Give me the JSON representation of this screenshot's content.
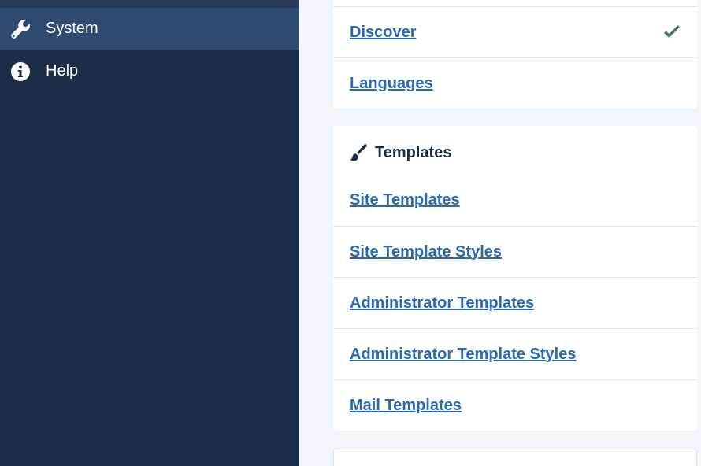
{
  "sidebar": {
    "items": [
      {
        "label": "System",
        "icon": "wrench-icon",
        "active": true
      },
      {
        "label": "Help",
        "icon": "info-icon",
        "active": false
      }
    ]
  },
  "install_card": {
    "links": [
      {
        "label": "Discover",
        "status_icon": "check-icon"
      },
      {
        "label": "Languages"
      }
    ]
  },
  "templates_card": {
    "title": "Templates",
    "icon": "paint-brush-icon",
    "links": [
      {
        "label": "Site Templates"
      },
      {
        "label": "Site Template Styles"
      },
      {
        "label": "Administrator Templates"
      },
      {
        "label": "Administrator Template Styles"
      },
      {
        "label": "Mail Templates"
      }
    ]
  },
  "colors": {
    "sidebar_bg": "#1c2d48",
    "sidebar_active": "#2f4a71",
    "link": "#2a69b8",
    "check": "#3f7f52",
    "page_bg": "#f0f4fb"
  }
}
